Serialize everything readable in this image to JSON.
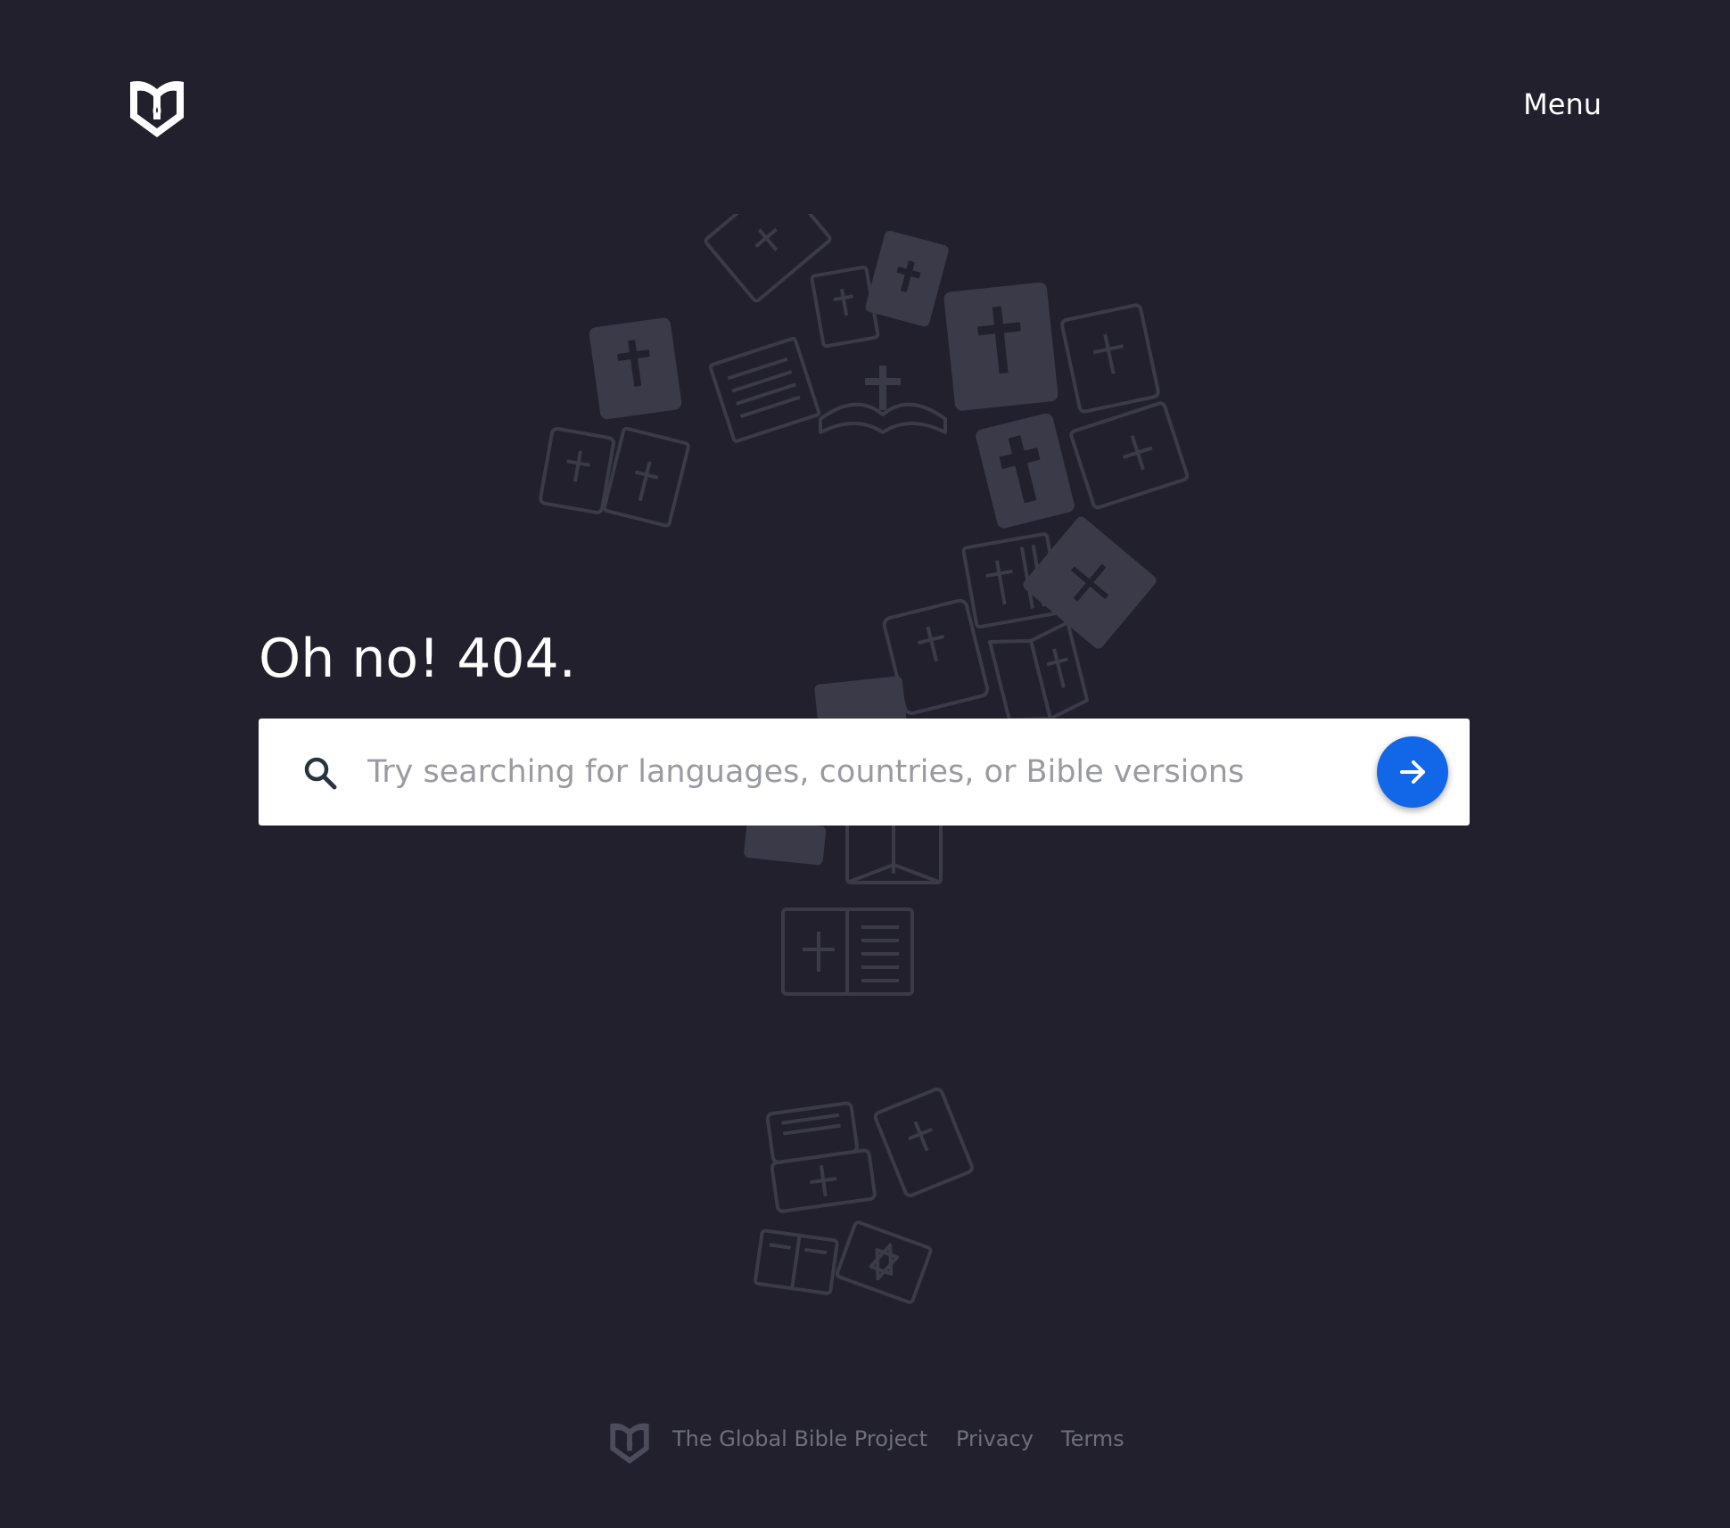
{
  "header": {
    "logo_icon": "book-logo-icon",
    "menu_label": "Menu"
  },
  "main": {
    "heading": "Oh no! 404.",
    "search": {
      "icon": "search-icon",
      "placeholder": "Try searching for languages, countries, or Bible versions",
      "value": "",
      "submit_icon": "arrow-right-icon"
    },
    "background_art": "question-mark-of-bible-icons"
  },
  "footer": {
    "logo_icon": "book-logo-icon",
    "title": "The Global Bible Project",
    "links": [
      "Privacy",
      "Terms"
    ]
  },
  "colors": {
    "background": "#21202c",
    "accent": "#1267e8",
    "footer_text": "#6f6e7e",
    "art": "#3b3a48"
  }
}
